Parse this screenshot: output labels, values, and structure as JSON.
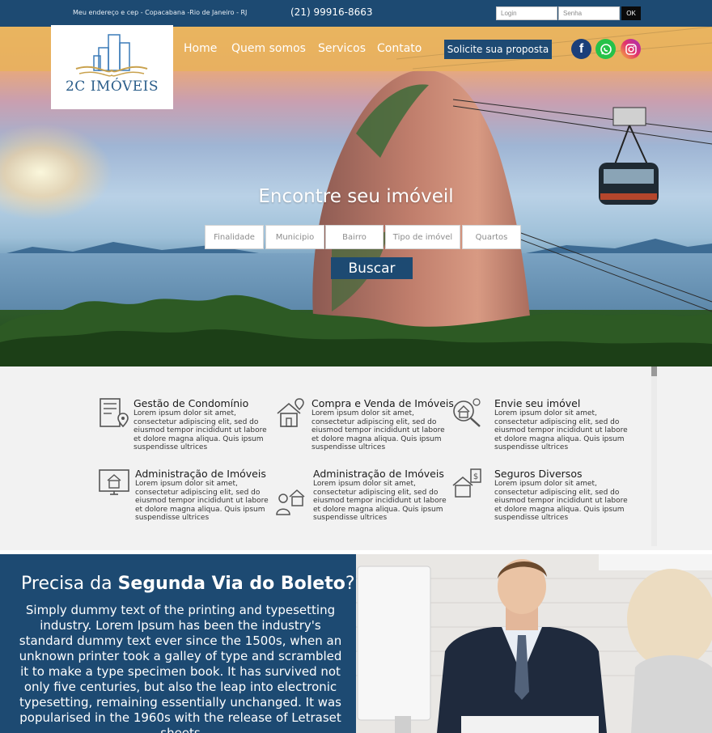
{
  "topbar": {
    "address": "Meu endereço e cep - Copacabana -Rio de Janeiro - RJ",
    "phone": "(21) 99916-8663",
    "login_placeholder": "Login",
    "password_placeholder": "Senha",
    "ok_label": "OK"
  },
  "logo": {
    "text": "2C IMÓVEIS"
  },
  "nav": {
    "home": "Home",
    "about": "Quem somos",
    "services": "Servicos",
    "contact": "Contato"
  },
  "cta": {
    "label": "Solicite sua proposta"
  },
  "social": {
    "facebook_icon": "facebook-icon",
    "whatsapp_icon": "whatsapp-icon",
    "instagram_icon": "instagram-icon",
    "facebook_glyph": "f"
  },
  "hero": {
    "title": "Encontre seu imóveil",
    "fields": [
      "Finalidade",
      "Municipio",
      "Bairro",
      "Tipo de imóvel",
      "Quartos"
    ],
    "search_label": "Buscar"
  },
  "services": [
    {
      "title": "Gestão de Condomínio",
      "text": "Lorem ipsum dolor sit amet, consectetur adipiscing elit, sed do eiusmod tempor incididunt ut labore et dolore magna aliqua. Quis ipsum suspendisse ultrices",
      "icon": "building-document-icon"
    },
    {
      "title": "Compra e Venda de Imóveis",
      "text": "Lorem ipsum dolor sit amet, consectetur adipiscing elit, sed do eiusmod tempor incididunt ut labore et dolore magna aliqua. Quis ipsum suspendisse ultrices",
      "icon": "house-location-icon"
    },
    {
      "title": "Envie seu imóvel",
      "text": "Lorem ipsum dolor sit amet, consectetur adipiscing elit, sed do eiusmod tempor incididunt ut labore et dolore magna aliqua. Quis ipsum suspendisse ultrices",
      "icon": "house-search-icon"
    },
    {
      "title": "Administração de Imóveis",
      "text": "Lorem ipsum dolor sit amet, consectetur adipiscing elit, sed do eiusmod tempor incididunt ut labore et dolore magna aliqua. Quis ipsum suspendisse ultrices",
      "icon": "house-monitor-icon"
    },
    {
      "title": "Administração de Imóveis",
      "text": "Lorem ipsum dolor sit amet, consectetur adipiscing elit, sed do eiusmod tempor incididunt ut labore et dolore magna aliqua. Quis ipsum suspendisse ultrices",
      "icon": "agent-house-icon"
    },
    {
      "title": "Seguros Diversos",
      "text": "Lorem ipsum dolor sit amet, consectetur adipiscing elit, sed do eiusmod tempor incididunt ut labore et dolore magna aliqua. Quis ipsum suspendisse ultrices",
      "icon": "house-dollar-icon"
    }
  ],
  "boleto": {
    "title_prefix": "Precisa da ",
    "title_bold": "Segunda Via do Boleto",
    "title_suffix": "?",
    "text": "Simply dummy text of the printing and typesetting industry. Lorem Ipsum has been the industry's standard dummy text ever since the 1500s, when an unknown printer took a galley of type and scrambled it to make a type specimen book. It has survived not only five centuries, but also the leap into electronic typesetting, remaining essentially unchanged. It was popularised in the 1960s with the release of Letraset sheets"
  },
  "colors": {
    "primary_blue": "#1d4a72",
    "topbar": "#1d4a72",
    "services_bg": "#f2f2f2",
    "whatsapp": "#25c249",
    "facebook": "#1b3f7a"
  }
}
